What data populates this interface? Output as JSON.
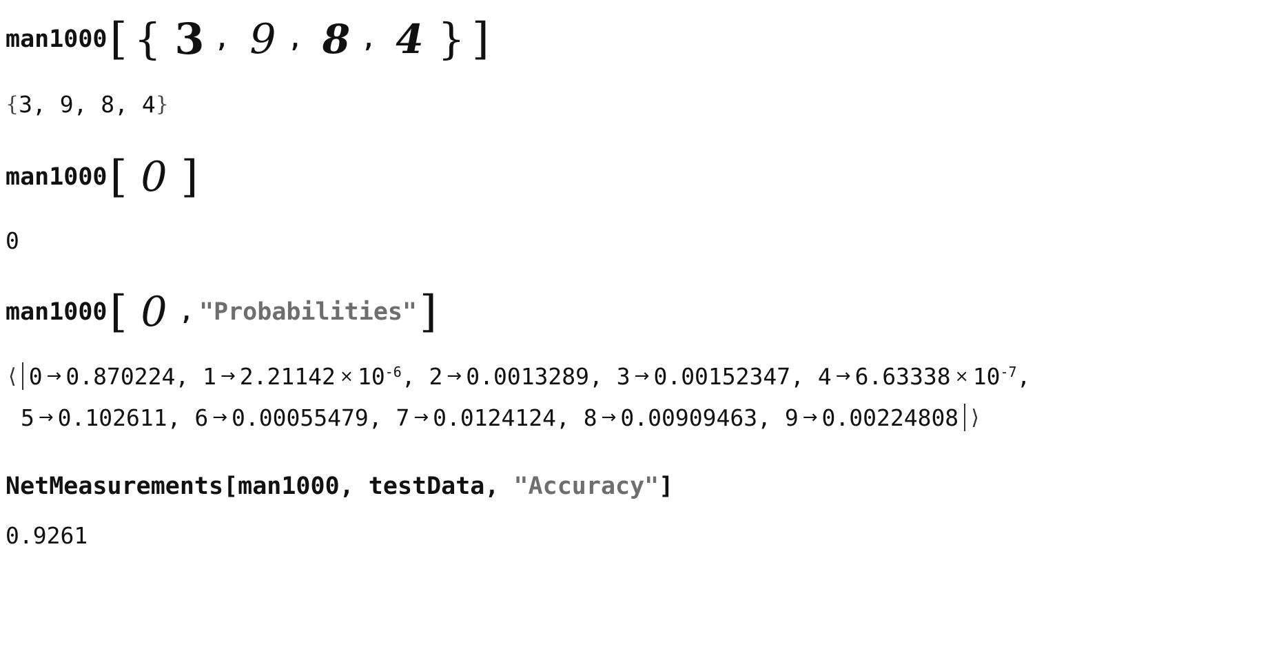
{
  "cells": {
    "in1": {
      "func": "man1000",
      "digits": [
        "3",
        "9",
        "8",
        "4"
      ],
      "sep": ","
    },
    "out1": {
      "open": "{",
      "text": "3, 9, 8, 4",
      "close": "}"
    },
    "in2": {
      "func": "man1000",
      "digit": "0"
    },
    "out2": {
      "text": "0"
    },
    "in3": {
      "func": "man1000",
      "digit": "0",
      "sep": ",",
      "arg": "\"Probabilities\""
    },
    "out3": {
      "open": "⟨",
      "close": "⟩",
      "line1": [
        {
          "key": "0",
          "val": "0.870224",
          "exp": ""
        },
        {
          "key": "1",
          "val": "2.21142",
          "exp": "-6"
        },
        {
          "key": "2",
          "val": "0.0013289",
          "exp": ""
        },
        {
          "key": "3",
          "val": "0.00152347",
          "exp": ""
        },
        {
          "key": "4",
          "val": "6.63338",
          "exp": "-7"
        }
      ],
      "line2": [
        {
          "key": "5",
          "val": "0.102611"
        },
        {
          "key": "6",
          "val": "0.00055479"
        },
        {
          "key": "7",
          "val": "0.0124124"
        },
        {
          "key": "8",
          "val": "0.00909463"
        },
        {
          "key": "9",
          "val": "0.00224808"
        }
      ],
      "arrow": "→",
      "times": "×",
      "ten": "10",
      "comma": ","
    },
    "in4": {
      "head": "NetMeasurements[man1000, testData, ",
      "arg": "\"Accuracy\"",
      "tail": "]"
    },
    "out4": {
      "text": "0.9261"
    }
  }
}
